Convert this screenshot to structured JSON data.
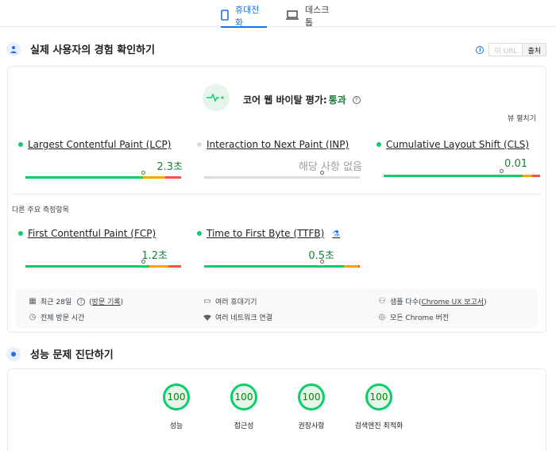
{
  "tabs": {
    "mobile": "휴대전화",
    "desktop": "데스크톱"
  },
  "field_section": {
    "title": "실제 사용자의 경험 확인하기",
    "url_option": "이 URL",
    "origin_option": "출처",
    "cwv_prefix": "코어 웹 바이탈 평가:",
    "cwv_result": "통과",
    "expand_label": "뷰 펼치기",
    "metrics": [
      {
        "name": "Largest Contentful Paint (LCP)",
        "value": "2.3초",
        "status": "good"
      },
      {
        "name": "Interaction to Next Paint (INP)",
        "value": "해당 사항 없음",
        "status": "none"
      },
      {
        "name": "Cumulative Layout Shift (CLS)",
        "value": "0.01",
        "status": "good"
      }
    ],
    "other_metrics_title": "다른 주요 측정항목",
    "other_metrics": [
      {
        "name": "First Contentful Paint (FCP)",
        "value": "1.2초",
        "status": "good"
      },
      {
        "name": "Time to First Byte (TTFB)",
        "value": "0.5초",
        "status": "good"
      }
    ],
    "footer": {
      "period_prefix": "최근 28일",
      "period_link": "방문 기록",
      "devices": "여러 휴대기기",
      "samples_prefix": "샘플 다수(",
      "samples_link": "Chrome UX 보고서",
      "samples_suffix": ")",
      "duration": "전체 방문 시간",
      "network": "여러 네트워크 연결",
      "chrome": "모든 Chrome 버전"
    }
  },
  "diagnose_section": {
    "title": "성능 문제 진단하기",
    "scores": [
      {
        "label": "성능",
        "score": "100"
      },
      {
        "label": "접근성",
        "score": "100"
      },
      {
        "label": "권장사항",
        "score": "100"
      },
      {
        "label": "검색엔진 최적화",
        "score": "100"
      }
    ]
  },
  "colors": {
    "accent": "#1a73e8",
    "good": "#0cce6b",
    "average": "#ffa400",
    "poor": "#ff4e42"
  }
}
